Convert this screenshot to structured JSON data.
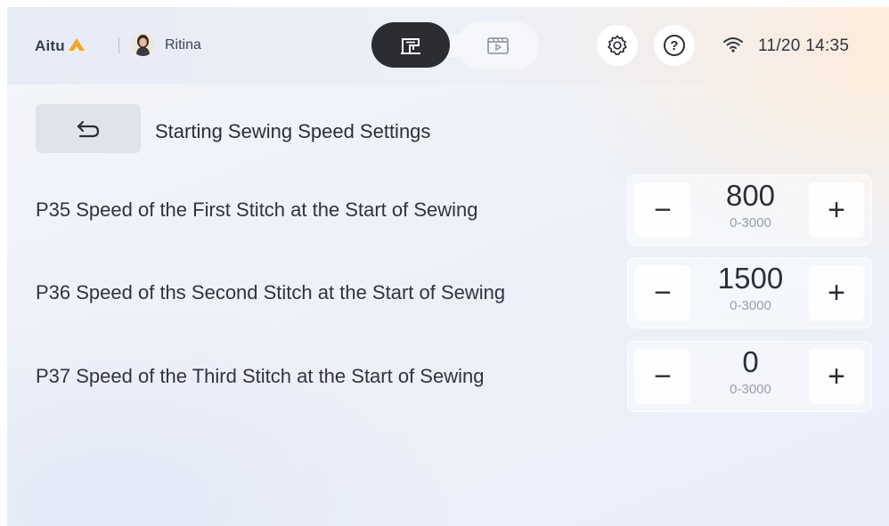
{
  "header": {
    "brand": "Aitu",
    "user_name": "Ritina",
    "datetime": "11/20 14:35",
    "icons": {
      "mode_sewing": "sewing-machine-icon",
      "mode_video": "video-play-icon",
      "settings": "gear-icon",
      "help": "help-icon",
      "wifi": "wifi-icon"
    },
    "help_glyph": "?"
  },
  "page": {
    "title": "Starting Sewing Speed Settings",
    "back_icon": "back-arrow-icon"
  },
  "params": [
    {
      "code": "P35",
      "label": "P35 Speed of the First Stitch at the Start of Sewing",
      "value": "800",
      "range": "0-3000",
      "minus": "−",
      "plus": "+"
    },
    {
      "code": "P36",
      "label": "P36 Speed of ths Second Stitch at the Start of Sewing",
      "value": "1500",
      "range": "0-3000",
      "minus": "−",
      "plus": "+"
    },
    {
      "code": "P37",
      "label": "P37 Speed of the Third Stitch at the Start of Sewing",
      "value": "0",
      "range": "0-3000",
      "minus": "−",
      "plus": "+"
    }
  ],
  "colors": {
    "accent_logo": "#f5a623",
    "dark": "#2b2d33"
  }
}
